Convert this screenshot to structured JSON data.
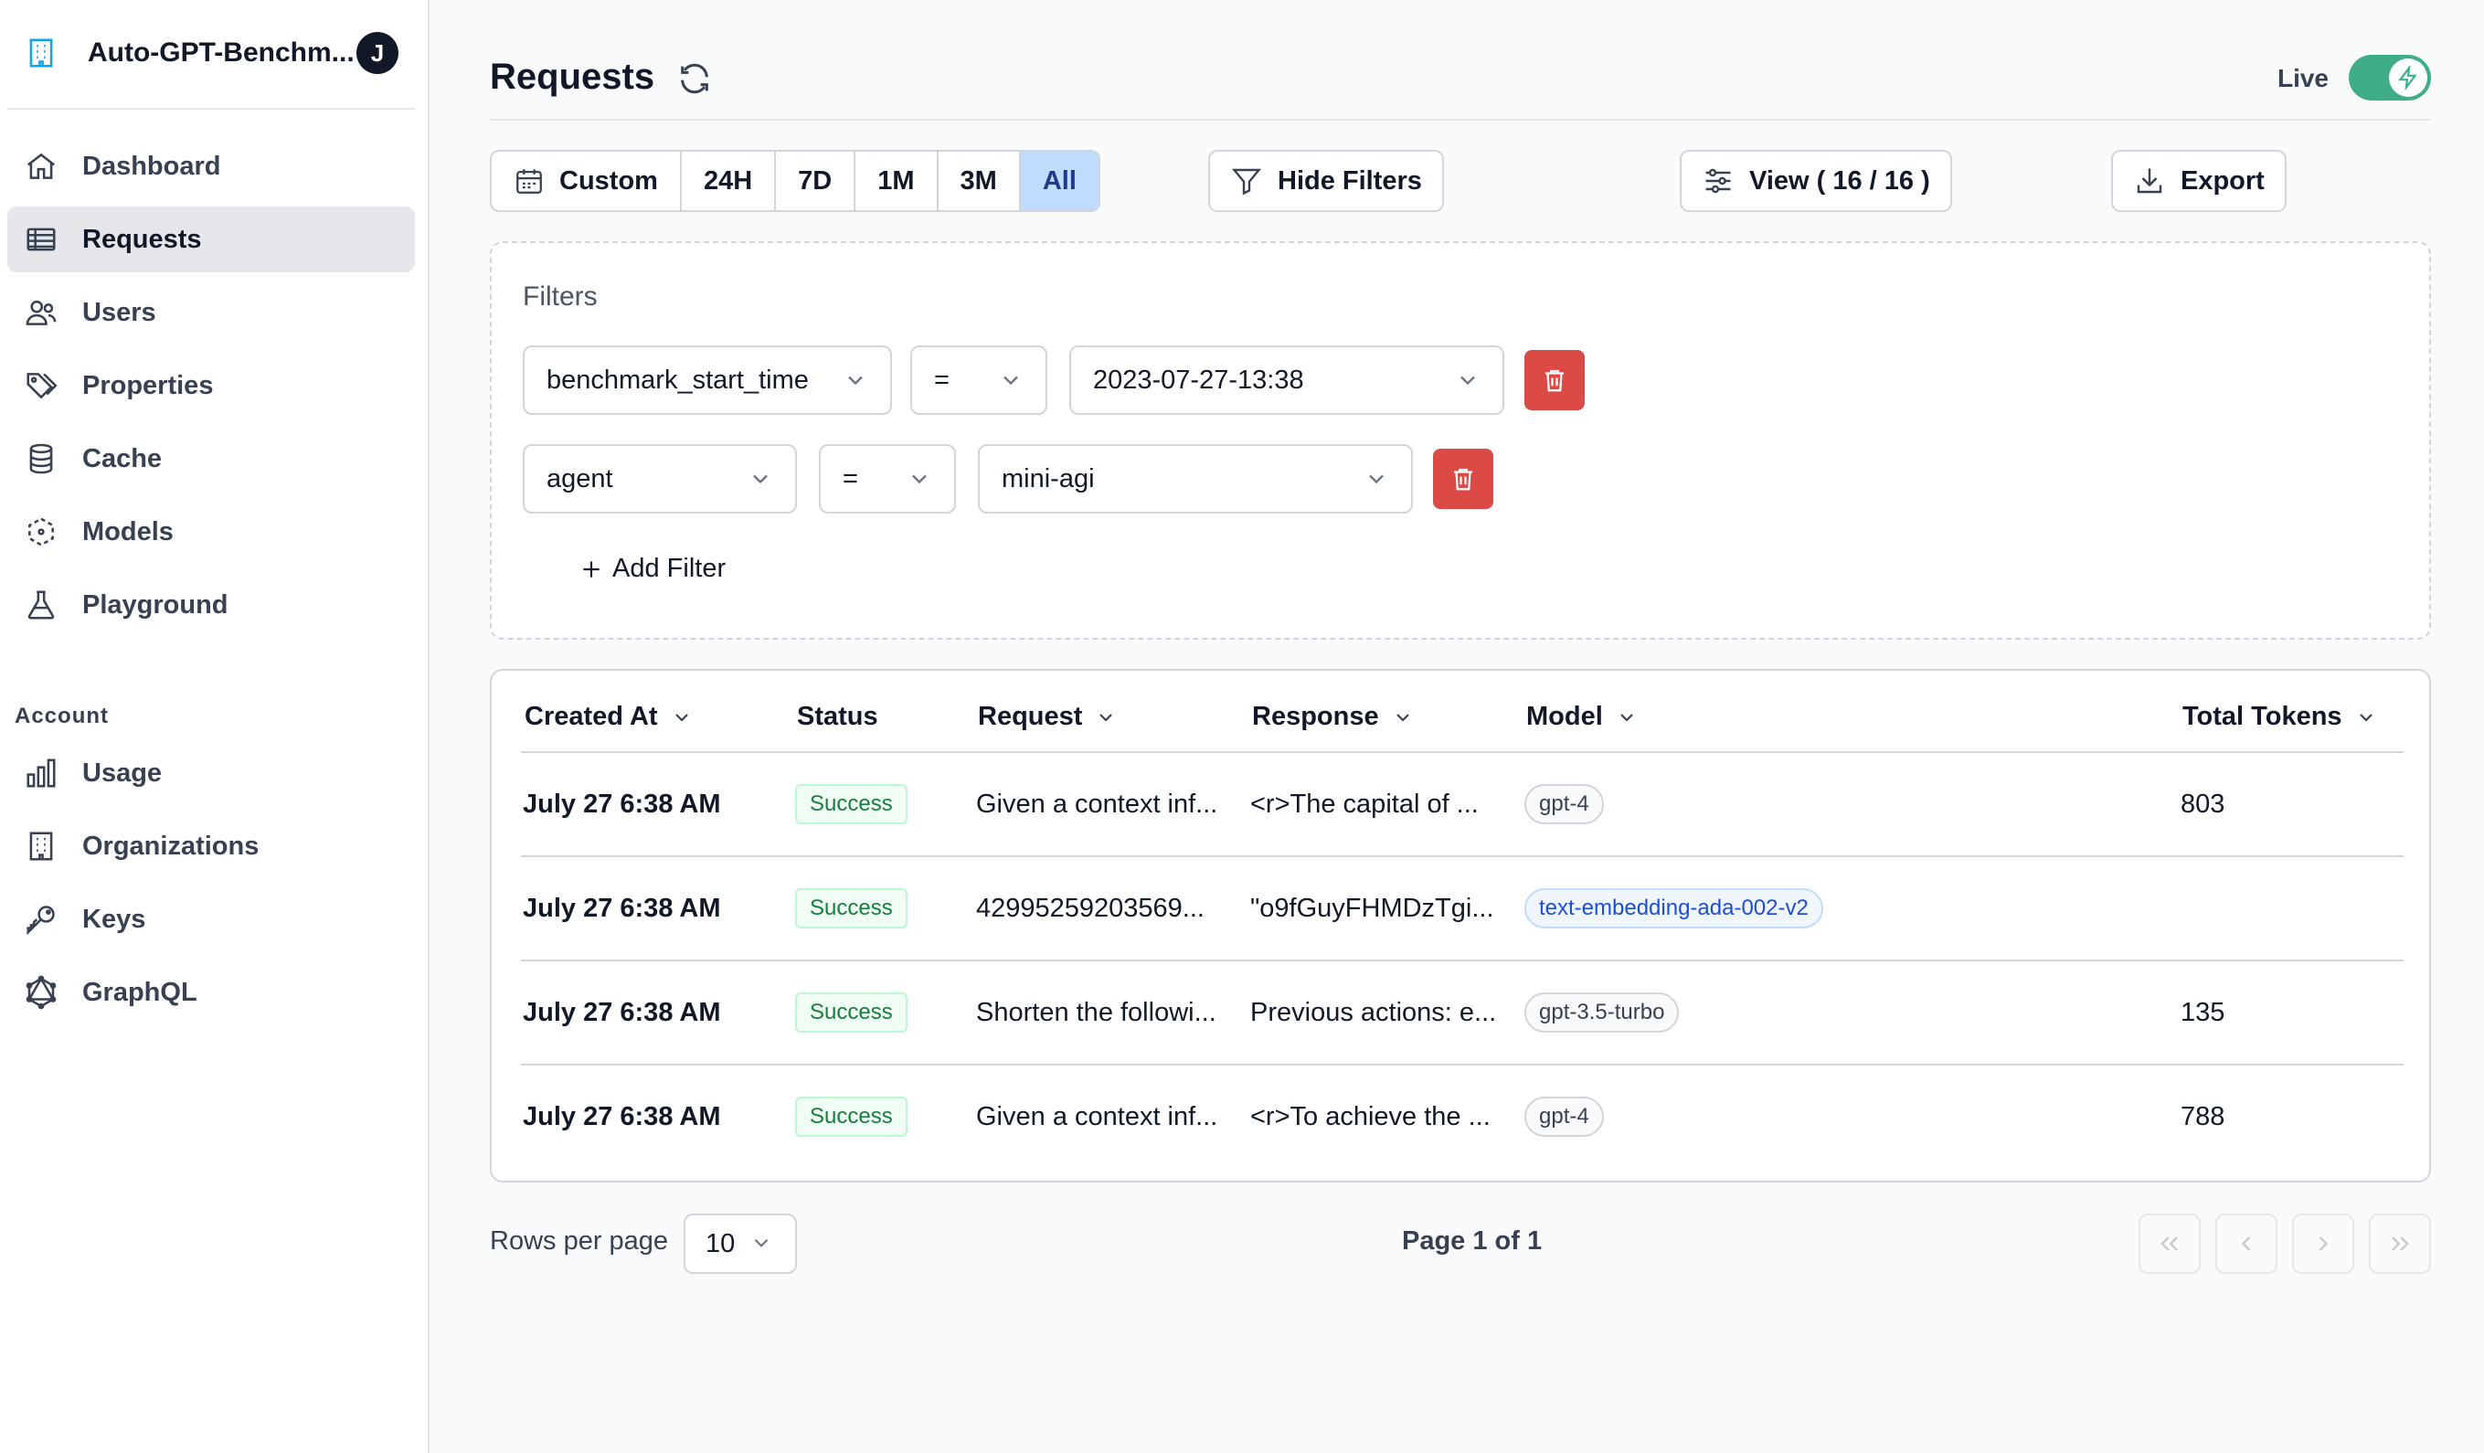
{
  "sidebar": {
    "org_name": "Auto-GPT-Benchm...",
    "avatar_letter": "J",
    "nav": [
      {
        "label": "Dashboard",
        "icon": "home-icon"
      },
      {
        "label": "Requests",
        "icon": "table-icon"
      },
      {
        "label": "Users",
        "icon": "users-icon"
      },
      {
        "label": "Properties",
        "icon": "tag-icon"
      },
      {
        "label": "Cache",
        "icon": "database-icon"
      },
      {
        "label": "Models",
        "icon": "cube-icon"
      },
      {
        "label": "Playground",
        "icon": "beaker-icon"
      }
    ],
    "account_label": "Account",
    "account_nav": [
      {
        "label": "Usage",
        "icon": "bar-chart-icon"
      },
      {
        "label": "Organizations",
        "icon": "building-icon"
      },
      {
        "label": "Keys",
        "icon": "key-icon"
      },
      {
        "label": "GraphQL",
        "icon": "graphql-icon"
      }
    ],
    "active_item": "Requests"
  },
  "header": {
    "title": "Requests",
    "live_label": "Live",
    "live_enabled": true
  },
  "time_range": {
    "options": [
      "Custom",
      "24H",
      "7D",
      "1M",
      "3M",
      "All"
    ],
    "selected": "All"
  },
  "actions": {
    "hide_filters": "Hide Filters",
    "view": "View ( 16 / 16 )",
    "export": "Export"
  },
  "filters": {
    "title": "Filters",
    "rows": [
      {
        "field": "benchmark_start_time",
        "operator": "=",
        "value": "2023-07-27-13:38"
      },
      {
        "field": "agent",
        "operator": "=",
        "value": "mini-agi"
      }
    ],
    "add_label": "Add Filter"
  },
  "table": {
    "columns": [
      "Created At",
      "Status",
      "Request",
      "Response",
      "Model",
      "Total Tokens"
    ],
    "rows": [
      {
        "created_at": "July 27 6:38 AM",
        "status": "Success",
        "request": "Given a context inf...",
        "response": "<r>The capital of ...",
        "model": "gpt-4",
        "total_tokens": "803"
      },
      {
        "created_at": "July 27 6:38 AM",
        "status": "Success",
        "request": "42995259203569...",
        "response": "\"o9fGuyFHMDzTgi...",
        "model": "text-embedding-ada-002-v2",
        "total_tokens": ""
      },
      {
        "created_at": "July 27 6:38 AM",
        "status": "Success",
        "request": "Shorten the followi...",
        "response": "Previous actions: e...",
        "model": "gpt-3.5-turbo",
        "total_tokens": "135"
      },
      {
        "created_at": "July 27 6:38 AM",
        "status": "Success",
        "request": "Given a context inf...",
        "response": "<r>To achieve the ...",
        "model": "gpt-4",
        "total_tokens": "788"
      }
    ]
  },
  "pagination": {
    "rows_per_page_label": "Rows per page",
    "rows_per_page": "10",
    "page_label": "Page 1 of 1"
  },
  "colors": {
    "toggle": "#3fae88",
    "delete": "#dc4a45",
    "range_active": "#bfdbfe",
    "success": "#15803d"
  }
}
